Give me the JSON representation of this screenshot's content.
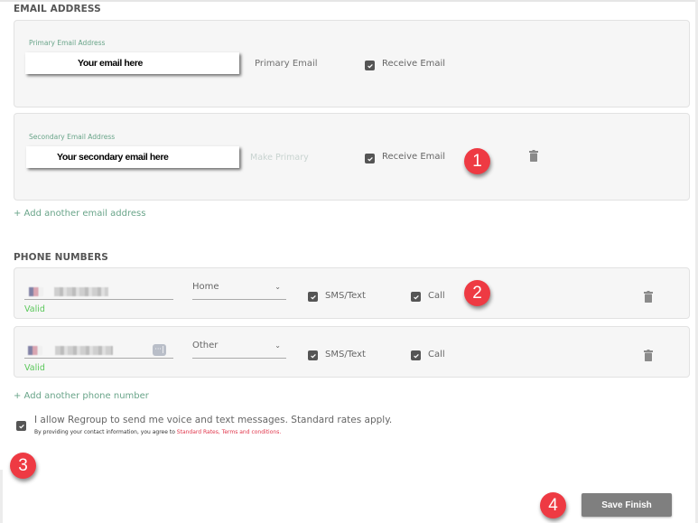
{
  "email_section": {
    "title": "EMAIL ADDRESS",
    "primary": {
      "label": "Primary Email Address",
      "value": "Your email here",
      "status": "Primary Email",
      "receive_label": "Receive Email",
      "receive_checked": true
    },
    "secondary": {
      "label": "Secondary Email Address",
      "value": "Your secondary email here",
      "make_primary": "Make Primary",
      "receive_label": "Receive Email",
      "receive_checked": true
    },
    "add_link": "+ Add another email address"
  },
  "phone_section": {
    "title": "PHONE NUMBERS",
    "phones": [
      {
        "type": "Home",
        "validation": "Valid",
        "sms_label": "SMS/Text",
        "sms_checked": true,
        "call_label": "Call",
        "call_checked": true
      },
      {
        "type": "Other",
        "validation": "Valid",
        "sms_label": "SMS/Text",
        "sms_checked": true,
        "call_label": "Call",
        "call_checked": true,
        "ext_icon": "···|"
      }
    ],
    "add_link": "+ Add another phone number"
  },
  "consent": {
    "checked": true,
    "main": "I allow Regroup to send me voice and text messages. Standard rates apply.",
    "sub_prefix": "By providing your contact information, you agree to ",
    "sub_link": "Standard Rates, Terms and conditions."
  },
  "annotations": {
    "one": "1",
    "two": "2",
    "three": "3",
    "four": "4"
  },
  "save_button": "Save Finish",
  "colors": {
    "accent_green": "#6aa58a",
    "valid_green": "#5cc85c",
    "badge_red": "#ee3a43",
    "button_gray": "#7f7f7f",
    "terms_red": "#e0354a"
  }
}
